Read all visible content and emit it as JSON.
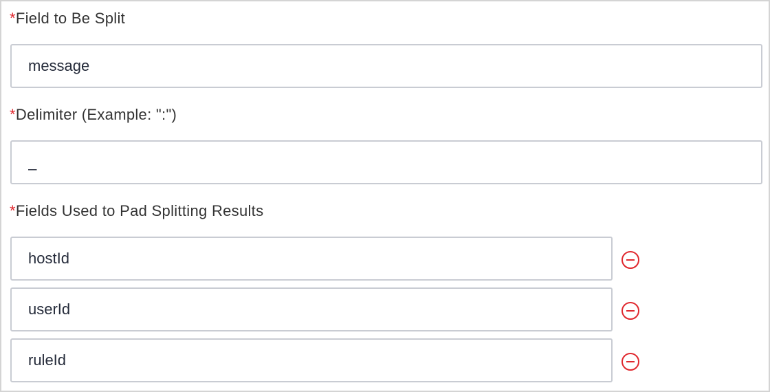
{
  "form": {
    "field_to_split": {
      "required_mark": "*",
      "label": "Field to Be Split",
      "value": "message"
    },
    "delimiter": {
      "required_mark": "*",
      "label": "Delimiter (Example: \":\")",
      "value": "_"
    },
    "pad_fields": {
      "required_mark": "*",
      "label": "Fields Used to Pad Splitting Results",
      "items": [
        {
          "value": "hostId"
        },
        {
          "value": "userId"
        },
        {
          "value": "ruleId"
        }
      ]
    }
  },
  "colors": {
    "required": "#e0282e",
    "remove_icon": "#e0282e",
    "input_border": "#c9ccd3"
  },
  "icons": {
    "remove": "minus-circle-icon"
  }
}
